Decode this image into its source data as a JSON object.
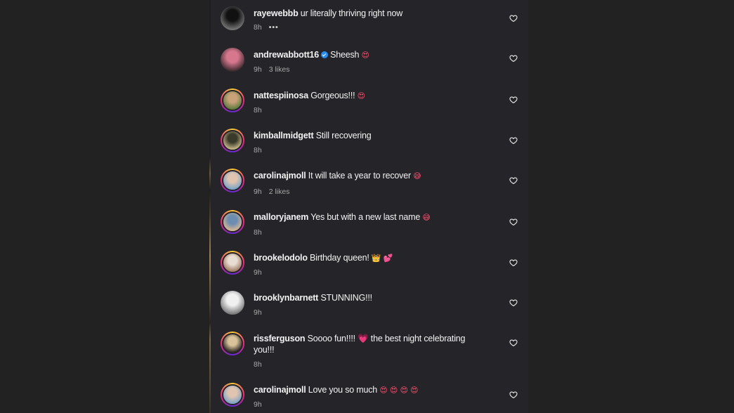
{
  "comments": [
    {
      "user": "rayewebbb",
      "verified": false,
      "text": "ur literally thriving right now",
      "emoji": "",
      "time": "8h",
      "likes": "",
      "more": "•••",
      "ring": false,
      "colors": [
        "#111",
        "#777"
      ]
    },
    {
      "user": "andrewabbott16",
      "verified": true,
      "text": "Sheesh",
      "emoji": "😍",
      "time": "9h",
      "likes": "3 likes",
      "more": "",
      "ring": false,
      "colors": [
        "#d6778e",
        "#3d2b2e"
      ]
    },
    {
      "user": "nattespiinosa",
      "verified": false,
      "text": "Gorgeous!!!",
      "emoji": "😍",
      "time": "8h",
      "likes": "",
      "more": "",
      "ring": true,
      "colors": [
        "#c9a27a",
        "#5e7a3d"
      ]
    },
    {
      "user": "kimballmidgett",
      "verified": false,
      "text": "Still recovering",
      "emoji": "",
      "time": "8h",
      "likes": "",
      "more": "",
      "ring": true,
      "colors": [
        "#3a3a2a",
        "#c9b98a"
      ]
    },
    {
      "user": "carolinajmoll",
      "verified": false,
      "text": "It will take a year to recover",
      "emoji": "😅",
      "time": "9h",
      "likes": "2 likes",
      "more": "",
      "ring": true,
      "colors": [
        "#e0c4b0",
        "#7aa3c8"
      ]
    },
    {
      "user": "malloryjanem",
      "verified": false,
      "text": "Yes but with a new last name",
      "emoji": "😅",
      "time": "8h",
      "likes": "",
      "more": "",
      "ring": true,
      "colors": [
        "#6c8db0",
        "#d8b894"
      ]
    },
    {
      "user": "brookelodolo",
      "verified": false,
      "text": "Birthday queen!",
      "emoji": "👑 💕",
      "time": "9h",
      "likes": "",
      "more": "",
      "ring": true,
      "colors": [
        "#e8ddd2",
        "#a07a63"
      ]
    },
    {
      "user": "brooklynbarnett",
      "verified": false,
      "text": "STUNNING!!!",
      "emoji": "",
      "time": "9h",
      "likes": "",
      "more": "",
      "ring": false,
      "colors": [
        "#f0f0f0",
        "#777"
      ]
    },
    {
      "user": "rissferguson",
      "verified": false,
      "text": "Soooo fun!!!! 💗 the best night celebrating you!!!",
      "emoji": "",
      "time": "8h",
      "likes": "",
      "more": "",
      "ring": true,
      "colors": [
        "#d9c39a",
        "#2d2824"
      ]
    },
    {
      "user": "carolinajmoll",
      "verified": false,
      "text": "Love you so much",
      "emoji": "😍 😍 😍 😍",
      "time": "9h",
      "likes": "",
      "more": "",
      "ring": true,
      "colors": [
        "#e0c4b0",
        "#7aa3c8"
      ]
    }
  ]
}
